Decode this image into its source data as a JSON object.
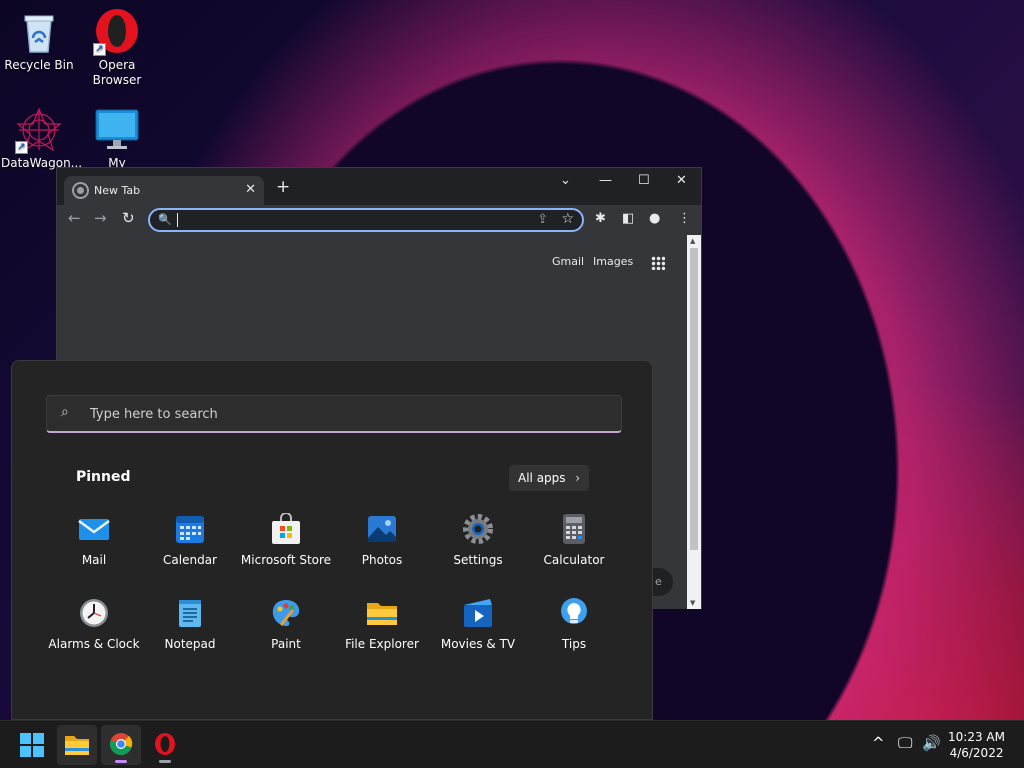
{
  "desktop": {
    "icons": [
      {
        "label": "Recycle Bin",
        "icon": "recycle-bin-icon"
      },
      {
        "label": "Opera\nBrowser",
        "icon": "opera-icon"
      },
      {
        "label": "DataWagon...",
        "icon": "datawagon-icon"
      },
      {
        "label": "My Computer",
        "icon": "monitor-icon"
      }
    ]
  },
  "chrome": {
    "tab_title": "New Tab",
    "new_tab_symbol": "+",
    "omnibox_value": "",
    "links": {
      "gmail": "Gmail",
      "images": "Images"
    },
    "pill_text": "e"
  },
  "start_menu": {
    "search_placeholder": "Type here to search",
    "pinned_title": "Pinned",
    "all_apps_label": "All apps",
    "apps": [
      {
        "label": "Mail",
        "icon": "mail-icon"
      },
      {
        "label": "Calendar",
        "icon": "calendar-icon"
      },
      {
        "label": "Microsoft Store",
        "icon": "store-icon"
      },
      {
        "label": "Photos",
        "icon": "photos-icon"
      },
      {
        "label": "Settings",
        "icon": "settings-gear-icon"
      },
      {
        "label": "Calculator",
        "icon": "calculator-icon"
      },
      {
        "label": "Alarms & Clock",
        "icon": "clock-icon"
      },
      {
        "label": "Notepad",
        "icon": "notepad-icon"
      },
      {
        "label": "Paint",
        "icon": "paint-icon"
      },
      {
        "label": "File Explorer",
        "icon": "folder-icon"
      },
      {
        "label": "Movies & TV",
        "icon": "movies-icon"
      },
      {
        "label": "Tips",
        "icon": "lightbulb-icon"
      }
    ]
  },
  "taskbar": {
    "time": "10:23 AM",
    "date": "4/6/2022"
  },
  "colors": {
    "accent": "#8ab4f8",
    "start_bg": "#242424",
    "taskbar_bg": "#1c1c1c"
  }
}
